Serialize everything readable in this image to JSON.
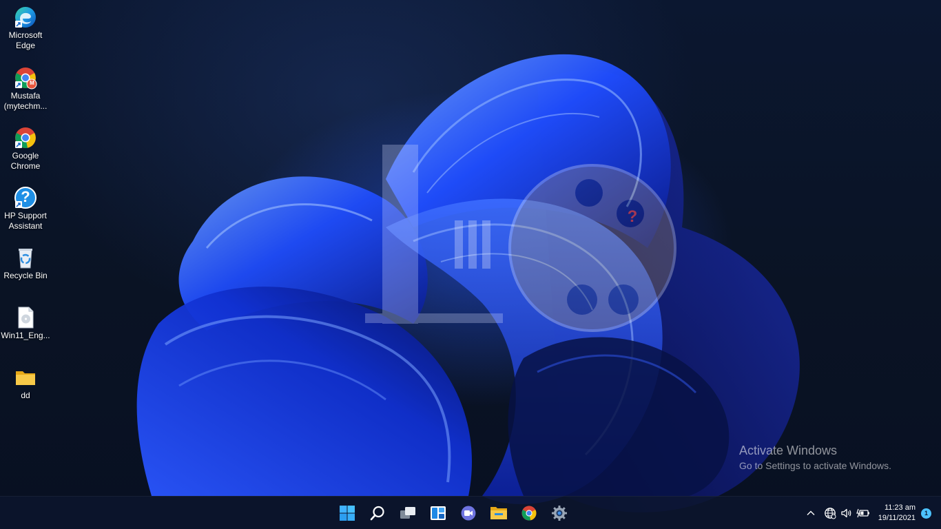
{
  "desktop_icons": [
    {
      "label": "Microsoft\nEdge",
      "icon": "edge-icon"
    },
    {
      "label": "Mustafa\n(mytechm...",
      "icon": "chrome-profile-icon",
      "badge": "M"
    },
    {
      "label": "Google\nChrome",
      "icon": "chrome-icon"
    },
    {
      "label": "HP Support\nAssistant",
      "icon": "hp-support-icon",
      "glyph": "?"
    },
    {
      "label": "Recycle Bin",
      "icon": "recycle-bin-icon"
    },
    {
      "label": "Win11_Eng...",
      "icon": "iso-file-icon"
    },
    {
      "label": "dd",
      "icon": "folder-icon"
    }
  ],
  "watermark": {
    "title": "Activate Windows",
    "subtitle": "Go to Settings to activate Windows."
  },
  "taskbar": {
    "apps": [
      "start-icon",
      "search-icon",
      "task-view-icon",
      "widgets-icon",
      "chat-icon",
      "file-explorer-icon",
      "chrome-icon",
      "settings-icon"
    ]
  },
  "tray": {
    "time": "11:23 am",
    "date": "19/11/2021",
    "notifications": "1"
  },
  "colors": {
    "accent": "#4cc2ff",
    "folder": "#f7c948",
    "wallpaper_blue": "#1f4dff"
  }
}
